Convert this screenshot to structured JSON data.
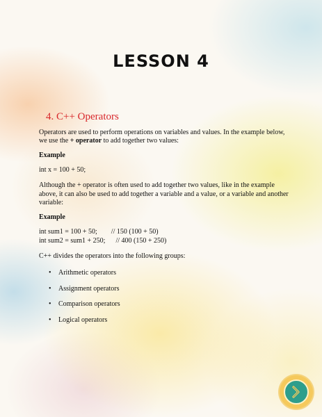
{
  "lesson_title": "LESSON 4",
  "section": {
    "heading": "4. C++ Operators",
    "intro_prefix": "Operators are used to perform operations on variables and values. In the example below, we use the ",
    "intro_op": "+ ",
    "intro_bold": "operator",
    "intro_suffix": " to add together two values:",
    "example1_label": "Example",
    "example1_code": "int x = 100 + 50;",
    "para2": "Although the + operator is often used to add together two values, like in the example above, it can also be used to add together a variable and a value, or a variable and another variable:",
    "example2_label": "Example",
    "example2_lines": [
      "int sum1 = 100 + 50;        // 150 (100 + 50)",
      "int sum2 = sum1 + 250;      // 400 (150 + 250)"
    ],
    "groups_intro": "C++ divides the operators into the following groups:",
    "groups": [
      "Arithmetic operators",
      "Assignment operators",
      "Comparison operators",
      "Logical operators"
    ]
  },
  "icons": {
    "next": "chevron-right-icon",
    "accent_teal": "#2e9e8c",
    "accent_gold": "#f5c95c",
    "heading_red": "#d8262a"
  }
}
